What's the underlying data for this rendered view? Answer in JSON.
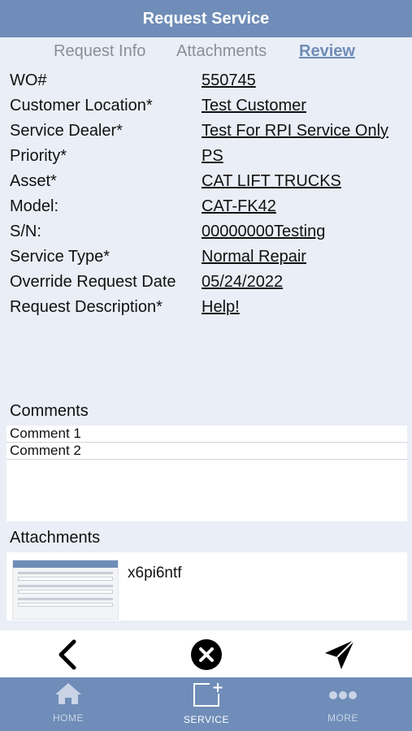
{
  "header": {
    "title": "Request Service"
  },
  "tabs": [
    {
      "label": "Request Info",
      "active": false
    },
    {
      "label": "Attachments",
      "active": false
    },
    {
      "label": "Review",
      "active": true
    }
  ],
  "fields": [
    {
      "label": "WO#",
      "value": "550745"
    },
    {
      "label": "Customer Location*",
      "value": "Test Customer"
    },
    {
      "label": "Service Dealer*",
      "value": "Test For RPI Service Only"
    },
    {
      "label": "Priority*",
      "value": "PS"
    },
    {
      "label": "Asset*",
      "value": "CAT LIFT TRUCKS"
    },
    {
      "label": "Model:",
      "value": "CAT-FK42"
    },
    {
      "label": "S/N:",
      "value": "00000000Testing"
    },
    {
      "label": "Service Type*",
      "value": "Normal Repair"
    },
    {
      "label": "Override Request Date",
      "value": "05/24/2022"
    },
    {
      "label": "Request Description*",
      "value": "Help!"
    }
  ],
  "comments": {
    "title": "Comments",
    "items": [
      "Comment 1",
      "Comment 2"
    ]
  },
  "attachments": {
    "title": "Attachments",
    "items": [
      {
        "name": "x6pi6ntf"
      }
    ]
  },
  "toolbar": {
    "back_icon": "chevron-left-icon",
    "cancel_icon": "close-circle-icon",
    "send_icon": "paper-plane-icon"
  },
  "tabbar": [
    {
      "label": "HOME",
      "icon": "home-icon",
      "active": false
    },
    {
      "label": "SERVICE",
      "icon": "new-request-icon",
      "active": true
    },
    {
      "label": "MORE",
      "icon": "more-icon",
      "active": false
    }
  ],
  "colors": {
    "brand": "#6f8db8",
    "background": "#eaeef6"
  }
}
